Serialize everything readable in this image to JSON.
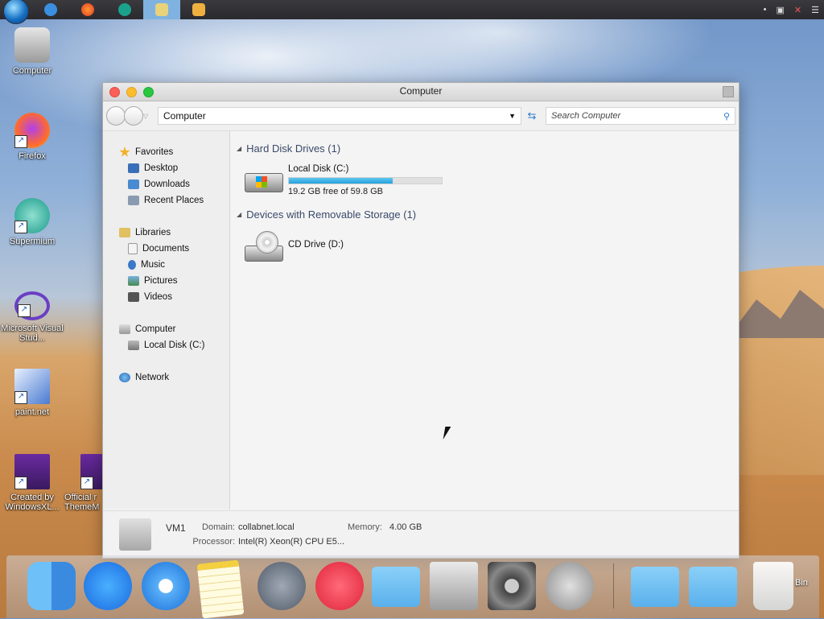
{
  "taskbar": {
    "apps": [
      "internet-explorer",
      "firefox",
      "supermium",
      "file-explorer",
      "media-player"
    ],
    "active_app": "file-explorer"
  },
  "desktop": {
    "icons": [
      {
        "label": "Computer"
      },
      {
        "label": "Firefox"
      },
      {
        "label": "Supermium"
      },
      {
        "label": "Microsoft Visual Stud..."
      },
      {
        "label": "paint.net"
      },
      {
        "label": "Created by WindowsXL..."
      },
      {
        "label": "Official r ThemeM"
      }
    ]
  },
  "window": {
    "title": "Computer",
    "address": "Computer",
    "search_placeholder": "Search Computer"
  },
  "sidebar": {
    "favorites": {
      "label": "Favorites",
      "items": [
        "Desktop",
        "Downloads",
        "Recent Places"
      ]
    },
    "libraries": {
      "label": "Libraries",
      "items": [
        "Documents",
        "Music",
        "Pictures",
        "Videos"
      ]
    },
    "computer": {
      "label": "Computer",
      "items": [
        "Local Disk (C:)"
      ]
    },
    "network": {
      "label": "Network"
    }
  },
  "main": {
    "hdd_section": "Hard Disk Drives (1)",
    "local_disk": {
      "name": "Local Disk (C:)",
      "free_text": "19.2 GB free of 59.8 GB",
      "used_fraction": 0.68
    },
    "removable_section": "Devices with Removable Storage (1)",
    "cd_drive": {
      "name": "CD Drive (D:)"
    }
  },
  "details": {
    "name": "VM1",
    "domain_label": "Domain:",
    "domain_value": "collabnet.local",
    "memory_label": "Memory:",
    "memory_value": "4.00 GB",
    "processor_label": "Processor:",
    "processor_value": "Intel(R) Xeon(R) CPU E5..."
  },
  "dock": {
    "items": [
      "finder",
      "app-store",
      "safari",
      "notes",
      "launchpad",
      "music",
      "applications-folder",
      "computer",
      "system-preferences",
      "shutdown",
      "documents-folder",
      "files-folder",
      "trash"
    ],
    "trash_label": "Bin"
  },
  "colors": {
    "progress_fill": "#27a1dc",
    "close": "#fc5f57",
    "minimize": "#fdbc2e",
    "maximize": "#28c840"
  }
}
